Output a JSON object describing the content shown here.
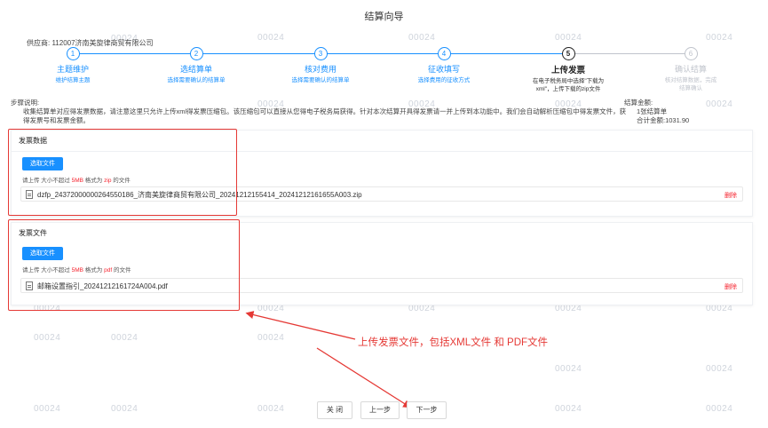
{
  "page_title": "结算向导",
  "supplier": "供应商: 112007济南美旋律商贸有限公司",
  "watermark": "00024",
  "colors": {
    "primary": "#1890ff",
    "danger": "#f5222d",
    "annotation": "#e53935",
    "pending": "#c0c4cc"
  },
  "steps": [
    {
      "number": "1",
      "title": "主题维护",
      "desc": "维护结算主题",
      "state": "done"
    },
    {
      "number": "2",
      "title": "选结算单",
      "desc": "选择需要确认的结算单",
      "state": "done"
    },
    {
      "number": "3",
      "title": "核对费用",
      "desc": "选择需要确认的结算单",
      "state": "done"
    },
    {
      "number": "4",
      "title": "征收填写",
      "desc": "选择费用的征收方式",
      "state": "done"
    },
    {
      "number": "5",
      "title": "上传发票",
      "desc": "在电子税务局中选择\"下载为xml\"，上传下载的zip文件",
      "state": "current"
    },
    {
      "number": "6",
      "title": "确认结算",
      "desc": "核对结算数据，完成结算确认",
      "state": "todo"
    }
  ],
  "instructions": {
    "label": "步骤说明:",
    "text": "收集结算单对应得发票数据，请注意这里只允许上传xml得发票压缩包。该压缩包可以直接从您得电子税务局获得。针对本次结算开具得发票请一并上传到本功能中。我们会自动解析压缩包中得发票文件，获得发票号和发票金额。"
  },
  "amount": {
    "label": "结算金额:",
    "count": "1张结算单",
    "total": "合计金额:1031.90"
  },
  "invoice_data": {
    "header": "发票数据",
    "select_label": "选取文件",
    "hint_prefix": "请上传 大小不超过 ",
    "hint_size": "5MB",
    "hint_mid": " 格式为 ",
    "hint_format": "zip",
    "hint_suffix": " 的文件",
    "file_name": "dzfp_24372000000264550186_济南美旋律商贸有限公司_20241212155414_20241212161655A003.zip",
    "delete_label": "删除"
  },
  "invoice_file": {
    "header": "发票文件",
    "select_label": "选取文件",
    "hint_prefix": "请上传 大小不超过 ",
    "hint_size": "5MB",
    "hint_mid": " 格式为 ",
    "hint_format": "pdf",
    "hint_suffix": " 的文件",
    "file_name": "邮箱设置指引_20241212161724A004.pdf",
    "delete_label": "删除"
  },
  "annotation": "上传发票文件，包括XML文件 和  PDF文件",
  "footer": {
    "close_label": "关 闭",
    "prev_label": "上一步",
    "next_label": "下一步"
  }
}
